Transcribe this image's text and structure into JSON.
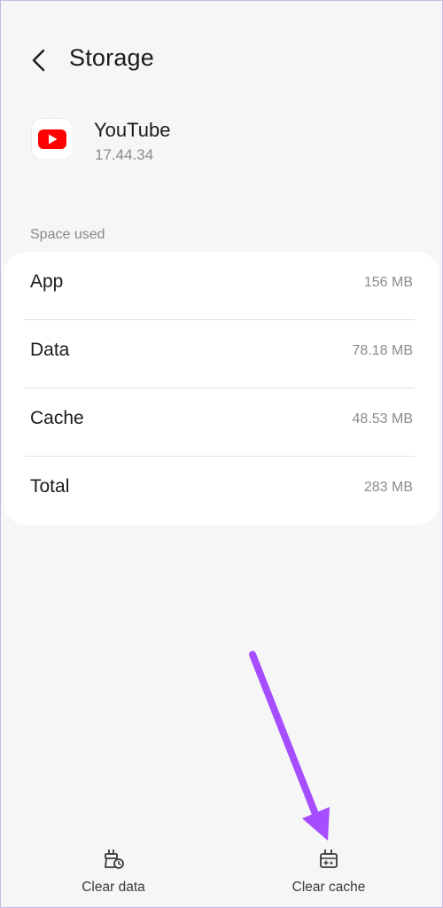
{
  "header": {
    "title": "Storage"
  },
  "app": {
    "name": "YouTube",
    "version": "17.44.34",
    "icon": "youtube-logo",
    "brand_color": "#ff0000"
  },
  "storage": {
    "section_label": "Space used",
    "rows": [
      {
        "label": "App",
        "value": "156 MB"
      },
      {
        "label": "Data",
        "value": "78.18 MB"
      },
      {
        "label": "Cache",
        "value": "48.53 MB"
      },
      {
        "label": "Total",
        "value": "283 MB"
      }
    ]
  },
  "bottom_bar": {
    "clear_data_label": "Clear data",
    "clear_cache_label": "Clear cache"
  },
  "annotation": {
    "arrow_color": "#a64dff"
  }
}
